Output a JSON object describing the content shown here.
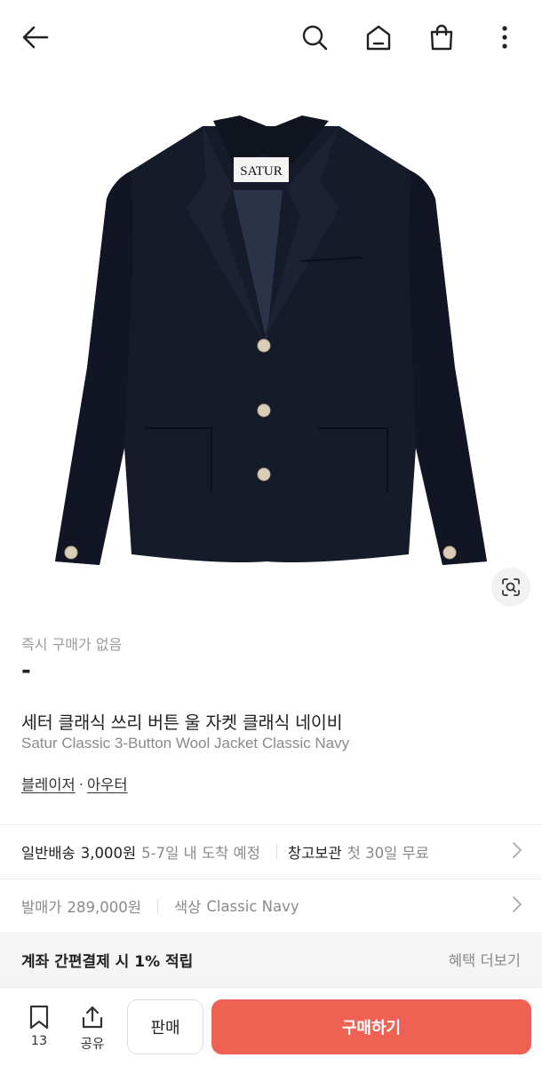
{
  "header": {
    "back_icon": "arrow-left-icon",
    "search_icon": "search-icon",
    "home_icon": "home-icon",
    "bag_icon": "shopping-bag-icon",
    "more_icon": "more-vertical-icon"
  },
  "product": {
    "brand_label": "SATUR",
    "instant_status": "즉시 구매가 없음",
    "price": "-",
    "name_ko": "세터 클래식 쓰리 버튼 울 자켓 클래식 네이비",
    "name_en": "Satur Classic 3-Button Wool Jacket Classic Navy",
    "categories": [
      "블레이저",
      "아우터"
    ],
    "category_separator": "·"
  },
  "shipping": {
    "label": "일반배송",
    "fee": "3,000원",
    "eta": "5-7일 내 도착 예정",
    "storage_label": "창고보관",
    "storage_note": "첫 30일 무료"
  },
  "release": {
    "label": "발매가",
    "price": "289,000원",
    "color_label": "색상",
    "color_value": "Classic Navy"
  },
  "benefit": {
    "title": "계좌 간편결제 시 1% 적립",
    "more": "혜택 더보기"
  },
  "bottom_bar": {
    "bookmark_count": "13",
    "share_label": "공유",
    "sell_label": "판매",
    "buy_label": "구매하기"
  },
  "colors": {
    "accent": "#ef6253",
    "jacket": "#161b2a",
    "muted_text": "#8a8a8a"
  }
}
